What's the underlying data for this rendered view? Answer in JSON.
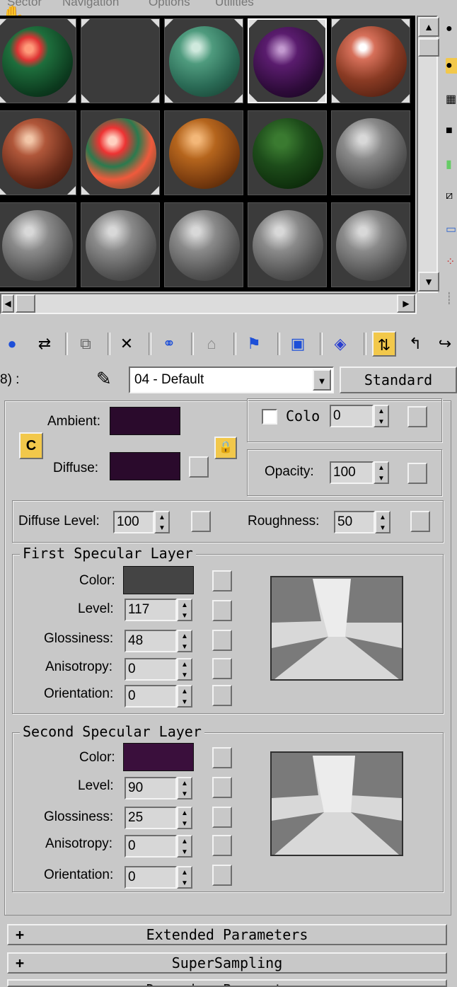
{
  "menu": [
    "Sector",
    "Navigation",
    "Options",
    "Utilities"
  ],
  "slots": [
    {
      "name": "slot-1",
      "style": "radial-gradient(circle at 38% 32%, #ff9a7a 0 6%, #d33 18%, #1e6e3c 30%, #0c3a1e 70%, #061f10 100%)",
      "active": false
    },
    {
      "name": "slot-2",
      "style": "none",
      "active": false
    },
    {
      "name": "slot-3",
      "style": "radial-gradient(circle at 38% 30%, #cfe9dd 0 6%, #4f9b7e 25%, #2a6a55 60%, #123528 100%)",
      "active": false
    },
    {
      "name": "slot-4",
      "style": "radial-gradient(circle at 40% 32%, #c39ad0 0 4%, #5a1c6e 25%, #2e0b3a 65%, #12041a 100%)",
      "active": true
    },
    {
      "name": "slot-5",
      "style": "radial-gradient(circle at 38% 30%, #ffffff 0 5%, #d7705a 18%, #8a3b24 50%, #3a1409 100%)",
      "active": false
    },
    {
      "name": "slot-6",
      "style": "radial-gradient(circle at 38% 30%, #f2c6a8 0 5%, #b0573a 25%, #6a2c1a 60%, #2c0f06 100%)",
      "active": false
    },
    {
      "name": "slot-7",
      "style": "radial-gradient(circle at 38% 32%, #ffd0c0 0 6%, #e33 20%, #2b7a4e 40%, #f05a3c 60%, #1e4e30 100%)",
      "active": false
    },
    {
      "name": "slot-8",
      "style": "radial-gradient(circle at 38% 30%, #f3b778 0 6%, #b5651d 30%, #7a3c0f 65%, #3a1a04 100%)",
      "active": false
    },
    {
      "name": "slot-9",
      "style": "radial-gradient(circle at 40% 32%, #3a7a30 0 10%, #1d4c1a 40%, #0c2a0a 80%, #051205 100%)",
      "active": false
    },
    {
      "name": "slot-10",
      "style": "radial-gradient(circle at 38% 30%, #d8d8d8 0 6%, #8a8a8a 30%, #555 65%, #2a2a2a 100%)",
      "active": false
    },
    {
      "name": "slot-11",
      "style": "radial-gradient(circle at 38% 30%, #d8d8d8 0 6%, #8a8a8a 30%, #555 65%, #2a2a2a 100%)",
      "active": false
    },
    {
      "name": "slot-12",
      "style": "radial-gradient(circle at 38% 30%, #d8d8d8 0 6%, #8a8a8a 30%, #555 65%, #2a2a2a 100%)",
      "active": false
    },
    {
      "name": "slot-13",
      "style": "radial-gradient(circle at 38% 30%, #d8d8d8 0 6%, #8a8a8a 30%, #555 65%, #2a2a2a 100%)",
      "active": false
    },
    {
      "name": "slot-14",
      "style": "radial-gradient(circle at 38% 30%, #d8d8d8 0 6%, #8a8a8a 30%, #555 65%, #2a2a2a 100%)",
      "active": false
    },
    {
      "name": "slot-15",
      "style": "radial-gradient(circle at 38% 30%, #d8d8d8 0 6%, #8a8a8a 30%, #555 65%, #2a2a2a 100%)",
      "active": false
    }
  ],
  "material": {
    "label_prefix": "8) :",
    "name": "04 - Default",
    "type": "Standard"
  },
  "basic": {
    "ambient_label": "Ambient:",
    "diffuse_label": "Diffuse:",
    "ambient_color": "#2a0a2c",
    "diffuse_color": "#2a0a2c",
    "color_label": "Colo",
    "color_value": "0",
    "opacity_label": "Opacity:",
    "opacity_value": "100",
    "diffuse_level_label": "Diffuse Level:",
    "diffuse_level_value": "100",
    "roughness_label": "Roughness:",
    "roughness_value": "50"
  },
  "first_specular": {
    "title": "First Specular Layer",
    "color_label": "Color:",
    "color": "#444444",
    "level_label": "Level:",
    "level": "117",
    "glossiness_label": "Glossiness:",
    "glossiness": "48",
    "anisotropy_label": "Anisotropy:",
    "anisotropy": "0",
    "orientation_label": "Orientation:",
    "orientation": "0"
  },
  "second_specular": {
    "title": "Second Specular Layer",
    "color_label": "Color:",
    "color": "#3a0f3c",
    "level_label": "Level:",
    "level": "90",
    "glossiness_label": "Glossiness:",
    "glossiness": "25",
    "anisotropy_label": "Anisotropy:",
    "anisotropy": "0",
    "orientation_label": "Orientation:",
    "orientation": "0"
  },
  "rollouts": [
    "Extended Parameters",
    "SuperSampling",
    "Dynamics Parameters"
  ],
  "accent": "#f2c84b"
}
